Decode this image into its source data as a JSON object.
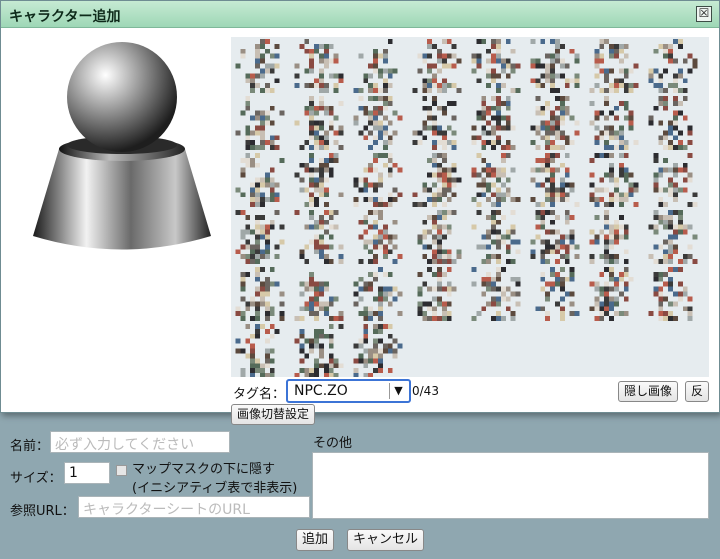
{
  "dialog": {
    "title": "キャラクター追加",
    "close_label": "☒"
  },
  "gallery": {
    "tag_label": "タグ名：",
    "tag_value": "NPC.ZO",
    "count_text": "0/43",
    "hide_button": "隠し画像",
    "reverse_button": "反",
    "switch_button": "画像切替設定"
  },
  "form": {
    "name_label": "名前：",
    "name_placeholder": "必ず入力してください",
    "size_label": "サイズ：",
    "size_value": "1",
    "mapmask_line1": "マップマスクの下に隠す",
    "mapmask_line2": "(イニシアティブ表で非表示)",
    "url_label": "参照URL：",
    "url_placeholder": "キャラクターシートのURL",
    "other_label": "その他",
    "add_button": "追加",
    "cancel_button": "キャンセル"
  },
  "colors": {
    "titlebar": "#a9dcbc",
    "background": "#8fa7b0",
    "gallery_bg": "#e6ecef"
  }
}
